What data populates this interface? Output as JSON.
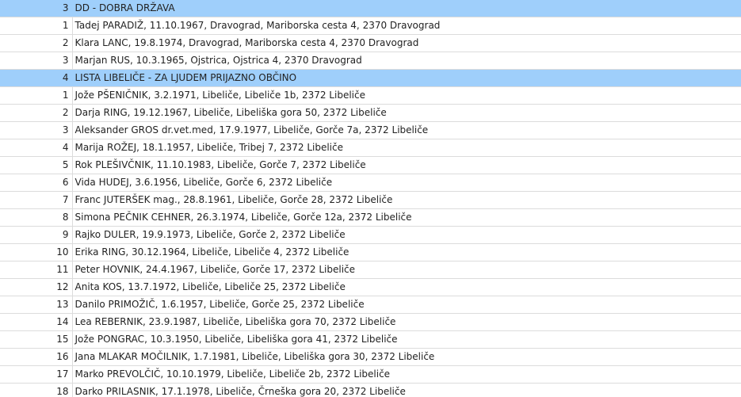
{
  "rows": [
    {
      "type": "header",
      "num": "3",
      "text": "DD - DOBRA DRŽAVA"
    },
    {
      "type": "item",
      "num": "1",
      "text": "Tadej PARADIŽ, 11.10.1967, Dravograd, Mariborska cesta 4, 2370 Dravograd"
    },
    {
      "type": "item",
      "num": "2",
      "text": "Klara LANC, 19.8.1974, Dravograd, Mariborska cesta 4, 2370 Dravograd"
    },
    {
      "type": "item",
      "num": "3",
      "text": "Marjan RUS, 10.3.1965, Ojstrica, Ojstrica 4, 2370 Dravograd"
    },
    {
      "type": "header",
      "num": "4",
      "text": "LISTA LIBELIČE - ZA LJUDEM PRIJAZNO OBČINO"
    },
    {
      "type": "item",
      "num": "1",
      "text": "Jože PŠENIČNIK, 3.2.1971, Libeliče, Libeliče 1b, 2372 Libeliče"
    },
    {
      "type": "item",
      "num": "2",
      "text": "Darja RING, 19.12.1967, Libeliče, Libeliška gora 50, 2372 Libeliče"
    },
    {
      "type": "item",
      "num": "3",
      "text": "Aleksander GROS dr.vet.med, 17.9.1977, Libeliče, Gorče 7a, 2372 Libeliče"
    },
    {
      "type": "item",
      "num": "4",
      "text": "Marija ROŽEJ, 18.1.1957, Libeliče, Tribej 7, 2372 Libeliče"
    },
    {
      "type": "item",
      "num": "5",
      "text": "Rok PLEŠIVČNIK, 11.10.1983, Libeliče, Gorče 7, 2372 Libeliče"
    },
    {
      "type": "item",
      "num": "6",
      "text": "Vida HUDEJ, 3.6.1956, Libeliče, Gorče 6, 2372 Libeliče"
    },
    {
      "type": "item",
      "num": "7",
      "text": "Franc JUTERŠEK mag., 28.8.1961, Libeliče, Gorče 28, 2372 Libeliče"
    },
    {
      "type": "item",
      "num": "8",
      "text": "Simona PEČNIK CEHNER, 26.3.1974, Libeliče, Gorče 12a, 2372 Libeliče"
    },
    {
      "type": "item",
      "num": "9",
      "text": "Rajko DULER, 19.9.1973, Libeliče, Gorče 2, 2372 Libeliče"
    },
    {
      "type": "item",
      "num": "10",
      "text": "Erika RING, 30.12.1964, Libeliče, Libeliče 4, 2372 Libeliče"
    },
    {
      "type": "item",
      "num": "11",
      "text": "Peter HOVNIK, 24.4.1967, Libeliče, Gorče 17, 2372 Libeliče"
    },
    {
      "type": "item",
      "num": "12",
      "text": "Anita KOS, 13.7.1972, Libeliče, Libeliče 25, 2372 Libeliče"
    },
    {
      "type": "item",
      "num": "13",
      "text": "Danilo PRIMOŽIČ, 1.6.1957, Libeliče, Gorče 25, 2372 Libeliče"
    },
    {
      "type": "item",
      "num": "14",
      "text": "Lea REBERNIK, 23.9.1987, Libeliče, Libeliška gora 70, 2372 Libeliče"
    },
    {
      "type": "item",
      "num": "15",
      "text": "Jože PONGRAC, 10.3.1950, Libeliče, Libeliška gora 41, 2372 Libeliče"
    },
    {
      "type": "item",
      "num": "16",
      "text": "Jana MLAKAR MOČILNIK, 1.7.1981, Libeliče, Libeliška gora 30, 2372 Libeliče"
    },
    {
      "type": "item",
      "num": "17",
      "text": "Marko PREVOLČIČ, 10.10.1979, Libeliče, Libeliče 2b, 2372 Libeliče"
    },
    {
      "type": "item",
      "num": "18",
      "text": "Darko PRILASNIK, 17.1.1978, Libeliče, Črneška gora 20, 2372 Libeliče"
    }
  ],
  "colors": {
    "header_bg": "#9fcffb",
    "grid_line": "#dcdcdc",
    "text": "#222222"
  }
}
